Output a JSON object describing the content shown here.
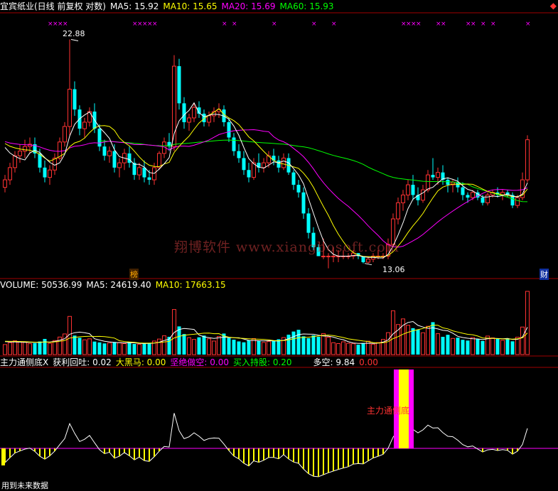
{
  "header": {
    "title": "宜宾纸业(日线 前复权 对数)",
    "ma5": "MA5: 15.92",
    "ma10": "MA10: 15.65",
    "ma20": "MA20: 15.69",
    "ma60": "MA60: 15.93"
  },
  "volume_header": {
    "volume": "VOLUME: 50536.99",
    "ma5": "MA5: 24619.40",
    "ma10": "MA10: 17663.15"
  },
  "indicator_header": {
    "name": "主力通侧底X",
    "profit": "获利回吐: 0.02",
    "black_horse": "大黑马: 0.00",
    "short": "坚绝做空: 0.00",
    "hold": "买入持股: 0.20",
    "longshort_label": "多空: 9.84",
    "longshort_value": "0.00"
  },
  "annotations": {
    "high": "22.88",
    "low": "13.06",
    "bang": "榜",
    "cai": "财",
    "signal": "主力通侧底",
    "future": "用到未来数据",
    "watermark": "翔博软件 www.xiangbosoft.com"
  },
  "colors": {
    "up": "#ff3232",
    "down": "#00ffff",
    "ma5": "#ffffff",
    "ma10": "#ffff00",
    "ma20": "#ff00ff",
    "ma60": "#00ff00",
    "frame": "#a00000",
    "signal_outer": "#ff00ff",
    "signal_inner": "#ffff00"
  },
  "chart_data": {
    "type": "candlestick",
    "price_scale": "log",
    "ylim": [
      12.8,
      24.2
    ],
    "high_marked": 22.88,
    "low_marked": 13.06,
    "candles": [
      [
        15.8,
        16.3,
        15.6,
        16.1
      ],
      [
        16.1,
        16.8,
        15.9,
        16.6
      ],
      [
        16.6,
        17.3,
        16.4,
        17.1
      ],
      [
        17.1,
        17.6,
        16.8,
        17.3
      ],
      [
        17.3,
        17.8,
        17.0,
        17.5
      ],
      [
        17.5,
        17.9,
        17.2,
        17.6
      ],
      [
        17.6,
        17.9,
        17.0,
        17.2
      ],
      [
        17.2,
        17.4,
        16.4,
        16.6
      ],
      [
        16.6,
        16.9,
        16.0,
        16.2
      ],
      [
        16.2,
        16.7,
        15.9,
        16.5
      ],
      [
        16.5,
        17.2,
        16.3,
        17.0
      ],
      [
        17.0,
        17.9,
        16.9,
        17.7
      ],
      [
        17.7,
        18.6,
        17.5,
        18.4
      ],
      [
        18.4,
        22.88,
        18.0,
        20.2
      ],
      [
        20.2,
        20.6,
        18.9,
        19.2
      ],
      [
        19.2,
        19.4,
        18.0,
        18.3
      ],
      [
        18.3,
        18.8,
        17.9,
        18.6
      ],
      [
        18.6,
        19.3,
        18.4,
        19.1
      ],
      [
        19.1,
        19.5,
        18.1,
        18.3
      ],
      [
        18.3,
        18.5,
        17.3,
        17.5
      ],
      [
        17.5,
        17.8,
        16.9,
        17.1
      ],
      [
        17.1,
        17.5,
        16.8,
        17.3
      ],
      [
        17.3,
        17.6,
        16.4,
        16.6
      ],
      [
        16.6,
        17.0,
        16.2,
        16.8
      ],
      [
        16.8,
        17.4,
        16.5,
        17.2
      ],
      [
        17.2,
        17.5,
        16.6,
        16.8
      ],
      [
        16.8,
        17.0,
        16.1,
        16.3
      ],
      [
        16.3,
        16.8,
        16.1,
        16.6
      ],
      [
        16.6,
        16.9,
        16.0,
        16.2
      ],
      [
        16.2,
        16.5,
        15.9,
        16.1
      ],
      [
        16.1,
        16.8,
        15.9,
        16.6
      ],
      [
        16.6,
        17.3,
        16.5,
        17.2
      ],
      [
        17.2,
        17.9,
        17.0,
        17.7
      ],
      [
        17.7,
        18.1,
        17.3,
        17.5
      ],
      [
        17.5,
        22.0,
        17.3,
        21.4
      ],
      [
        21.4,
        21.8,
        19.2,
        19.5
      ],
      [
        19.5,
        19.8,
        18.3,
        18.6
      ],
      [
        18.6,
        19.0,
        18.2,
        18.8
      ],
      [
        18.8,
        19.5,
        18.6,
        19.3
      ],
      [
        19.3,
        19.6,
        18.8,
        19.0
      ],
      [
        19.0,
        19.2,
        18.4,
        18.6
      ],
      [
        18.6,
        19.1,
        18.4,
        18.9
      ],
      [
        18.9,
        19.3,
        18.6,
        19.1
      ],
      [
        19.1,
        19.5,
        18.8,
        19.2
      ],
      [
        19.2,
        19.4,
        18.4,
        18.6
      ],
      [
        18.6,
        18.8,
        17.7,
        17.9
      ],
      [
        17.9,
        18.1,
        17.1,
        17.3
      ],
      [
        17.3,
        17.6,
        16.8,
        17.0
      ],
      [
        17.0,
        17.3,
        16.3,
        16.5
      ],
      [
        16.5,
        16.8,
        16.0,
        16.2
      ],
      [
        16.2,
        17.0,
        16.1,
        16.8
      ],
      [
        16.8,
        17.2,
        16.4,
        16.6
      ],
      [
        16.6,
        17.0,
        16.4,
        16.8
      ],
      [
        16.8,
        17.3,
        16.6,
        17.1
      ],
      [
        17.1,
        17.4,
        16.7,
        16.9
      ],
      [
        16.9,
        17.1,
        16.4,
        16.6
      ],
      [
        16.6,
        17.2,
        16.5,
        17.0
      ],
      [
        17.0,
        17.2,
        16.3,
        16.4
      ],
      [
        16.4,
        16.5,
        15.7,
        15.9
      ],
      [
        15.9,
        16.1,
        15.4,
        15.6
      ],
      [
        15.6,
        15.8,
        14.6,
        14.8
      ],
      [
        14.8,
        15.0,
        13.9,
        14.1
      ],
      [
        14.1,
        14.3,
        13.5,
        13.6
      ],
      [
        13.6,
        13.7,
        13.3,
        13.3
      ],
      [
        13.3,
        13.9,
        13.2,
        13.3
      ],
      [
        13.3,
        13.4,
        12.9,
        13.3
      ],
      [
        13.3,
        13.6,
        13.1,
        13.3
      ],
      [
        13.3,
        13.5,
        13.1,
        13.3
      ],
      [
        13.3,
        13.5,
        13.2,
        13.3
      ],
      [
        13.3,
        13.4,
        13.2,
        13.3
      ],
      [
        13.3,
        13.5,
        13.2,
        13.4
      ],
      [
        13.4,
        13.4,
        13.2,
        13.3
      ],
      [
        13.3,
        13.3,
        13.06,
        13.1
      ],
      [
        13.1,
        13.3,
        13.06,
        13.2
      ],
      [
        13.2,
        13.4,
        13.1,
        13.3
      ],
      [
        13.3,
        13.5,
        13.2,
        13.3
      ],
      [
        13.3,
        13.4,
        13.2,
        13.3
      ],
      [
        13.3,
        13.9,
        13.2,
        13.7
      ],
      [
        13.7,
        14.8,
        13.6,
        14.6
      ],
      [
        14.6,
        15.4,
        14.4,
        15.2
      ],
      [
        15.2,
        15.7,
        14.9,
        15.5
      ],
      [
        15.5,
        16.1,
        15.3,
        15.9
      ],
      [
        15.9,
        16.3,
        15.3,
        15.5
      ],
      [
        15.5,
        15.8,
        15.1,
        15.3
      ],
      [
        15.3,
        15.9,
        15.2,
        15.7
      ],
      [
        15.7,
        16.5,
        15.6,
        16.3
      ],
      [
        16.3,
        17.0,
        16.1,
        16.2
      ],
      [
        16.2,
        16.6,
        15.9,
        16.4
      ],
      [
        16.4,
        16.7,
        15.9,
        16.1
      ],
      [
        16.1,
        16.2,
        15.6,
        15.9
      ],
      [
        15.9,
        16.1,
        15.6,
        16.0
      ],
      [
        16.0,
        16.2,
        15.6,
        15.8
      ],
      [
        15.8,
        16.0,
        15.3,
        15.5
      ],
      [
        15.5,
        15.6,
        15.2,
        15.4
      ],
      [
        15.4,
        15.7,
        15.3,
        15.6
      ],
      [
        15.6,
        15.7,
        15.3,
        15.4
      ],
      [
        15.4,
        15.5,
        15.1,
        15.2
      ],
      [
        15.2,
        15.6,
        15.1,
        15.5
      ],
      [
        15.5,
        15.7,
        15.4,
        15.6
      ],
      [
        15.6,
        15.8,
        15.4,
        15.5
      ],
      [
        15.5,
        15.7,
        15.3,
        15.6
      ],
      [
        15.6,
        15.7,
        15.4,
        15.5
      ],
      [
        15.5,
        15.6,
        15.0,
        15.1
      ],
      [
        15.1,
        15.5,
        15.0,
        15.4
      ],
      [
        15.4,
        16.4,
        15.3,
        16.1
      ],
      [
        16.1,
        18.0,
        16.0,
        17.8
      ]
    ],
    "volume": [
      8000,
      9500,
      11000,
      10200,
      9800,
      8700,
      9200,
      10500,
      12500,
      9000,
      11200,
      14000,
      16500,
      30500,
      15200,
      13400,
      11800,
      12600,
      10400,
      9700,
      8900,
      9300,
      10100,
      9600,
      8800,
      9900,
      8500,
      8200,
      8700,
      9400,
      10800,
      12400,
      15000,
      14200,
      36000,
      22500,
      16400,
      13500,
      12100,
      13800,
      15200,
      12600,
      10800,
      14500,
      16800,
      13200,
      11900,
      10500,
      9800,
      11500,
      12800,
      10900,
      9700,
      10400,
      11100,
      12200,
      13600,
      15900,
      18400,
      19800,
      14600,
      13100,
      15400,
      14200,
      16800,
      13900,
      9500,
      8800,
      10200,
      9000,
      8700,
      7900,
      9200,
      10700,
      8300,
      9600,
      12100,
      17500,
      35000,
      24000,
      28500,
      23400,
      21100,
      19800,
      17400,
      22600,
      25900,
      16700,
      14200,
      15800,
      12900,
      13500,
      11800,
      11200,
      13600,
      12400,
      10900,
      14800,
      13300,
      12700,
      11400,
      12200,
      10600,
      13900,
      22000,
      50536.99
    ],
    "bottom_signal_index": 79
  }
}
